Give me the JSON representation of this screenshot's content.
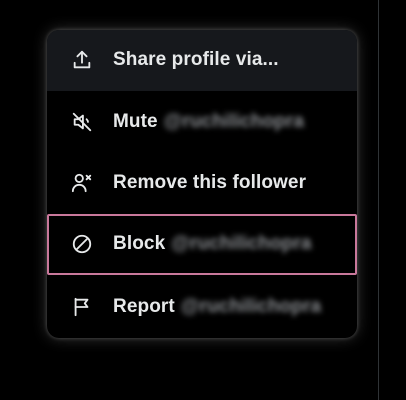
{
  "menu": {
    "items": [
      {
        "id": "share",
        "icon": "share-icon",
        "label": "Share profile via...",
        "handle": ""
      },
      {
        "id": "mute",
        "icon": "mute-icon",
        "label": "Mute",
        "handle": "@ruchilichopra"
      },
      {
        "id": "remove",
        "icon": "remove-follower-icon",
        "label": "Remove this follower",
        "handle": ""
      },
      {
        "id": "block",
        "icon": "block-icon",
        "label": "Block",
        "handle": "@ruchilichopra"
      },
      {
        "id": "report",
        "icon": "flag-icon",
        "label": "Report",
        "handle": "@ruchilichopra"
      }
    ]
  },
  "colors": {
    "text": "#e7e9ea",
    "hover_bg": "#16181c",
    "focus_border": "#c9789b",
    "divider": "#2f3336"
  }
}
